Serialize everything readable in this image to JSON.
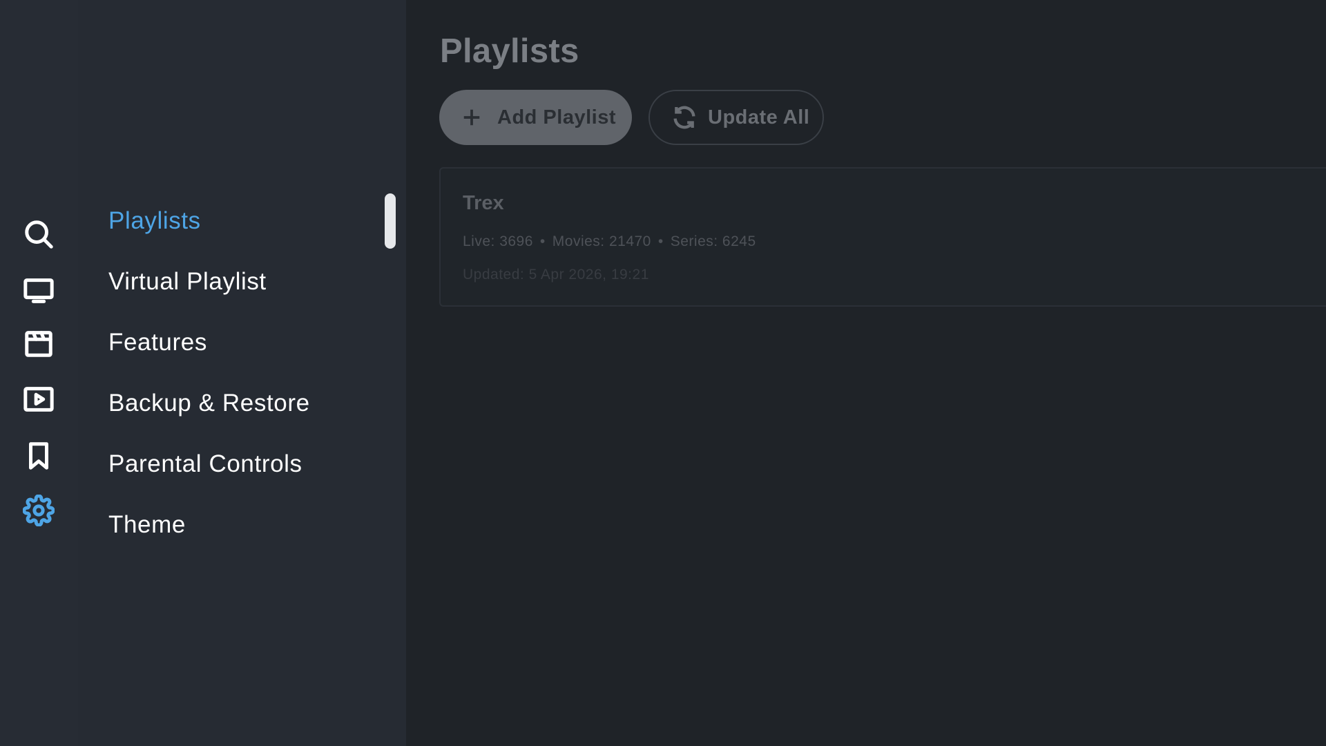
{
  "rail": {
    "items": [
      {
        "icon": "search-icon"
      },
      {
        "icon": "tv-icon"
      },
      {
        "icon": "movies-icon"
      },
      {
        "icon": "series-icon"
      },
      {
        "icon": "bookmark-icon"
      },
      {
        "icon": "gear-icon",
        "active": true
      }
    ],
    "accent_color": "#4ea5e6"
  },
  "settings_menu": {
    "items": [
      {
        "label": "Playlists",
        "active": true
      },
      {
        "label": "Virtual Playlist"
      },
      {
        "label": "Features"
      },
      {
        "label": "Backup & Restore"
      },
      {
        "label": "Parental Controls"
      },
      {
        "label": "Theme"
      }
    ]
  },
  "main": {
    "title": "Playlists",
    "add_button_label": "Add Playlist",
    "update_button_label": "Update All",
    "playlists": [
      {
        "name": "Trex",
        "stats": {
          "live": "Live: 3696",
          "movies": "Movies: 21470",
          "series": "Series: 6245",
          "separator": "•"
        },
        "updated": "Updated: 5 Apr 2026, 19:21"
      }
    ]
  }
}
